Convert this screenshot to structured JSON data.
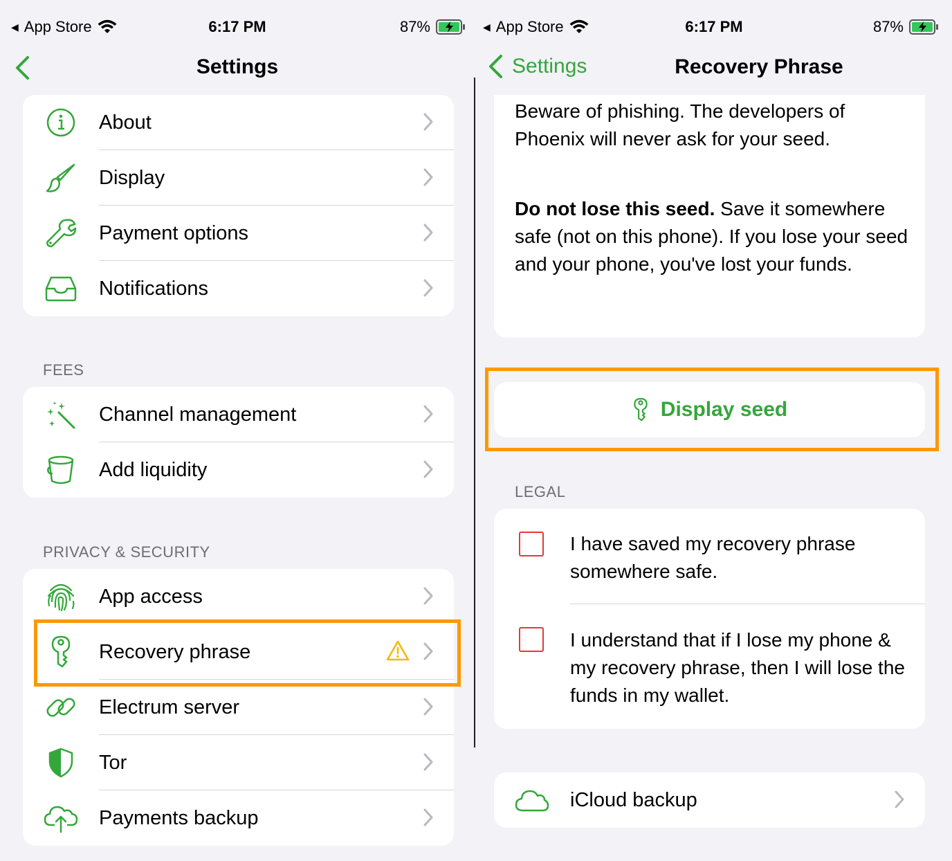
{
  "status_bar": {
    "back_app": "App Store",
    "time": "6:17 PM",
    "battery": "87%"
  },
  "left": {
    "nav_title": "Settings",
    "general": [
      {
        "label": "About",
        "icon": "info-icon"
      },
      {
        "label": "Display",
        "icon": "paintbrush-icon"
      },
      {
        "label": "Payment options",
        "icon": "wrench-icon"
      },
      {
        "label": "Notifications",
        "icon": "tray-icon"
      }
    ],
    "fees_header": "FEES",
    "fees": [
      {
        "label": "Channel management",
        "icon": "magic-wand-icon"
      },
      {
        "label": "Add liquidity",
        "icon": "bucket-icon"
      }
    ],
    "privacy_header": "PRIVACY & SECURITY",
    "privacy": [
      {
        "label": "App access",
        "icon": "fingerprint-icon"
      },
      {
        "label": "Recovery phrase",
        "icon": "key-icon"
      },
      {
        "label": "Electrum server",
        "icon": "link-icon"
      },
      {
        "label": "Tor",
        "icon": "shield-icon"
      },
      {
        "label": "Payments backup",
        "icon": "cloud-upload-icon"
      }
    ]
  },
  "right": {
    "back_label": "Settings",
    "nav_title": "Recovery Phrase",
    "warning_p1": "Beware of phishing. The developers of Phoenix will never ask for your seed.",
    "warning_p2_bold": "Do not lose this seed.",
    "warning_p2_rest": " Save it somewhere safe (not on this phone). If you lose your seed and your phone, you've lost your funds.",
    "display_seed": "Display seed",
    "legal_header": "LEGAL",
    "legal_1": "I have saved my recovery phrase somewhere safe.",
    "legal_2": "I understand that if I lose my phone & my recovery phrase, then I will lose the funds in my wallet.",
    "icloud_backup": "iCloud backup"
  },
  "colors": {
    "accent": "#34a73a",
    "highlight": "#ff9800",
    "warning": "#f5b800",
    "checkbox": "#e53935"
  }
}
